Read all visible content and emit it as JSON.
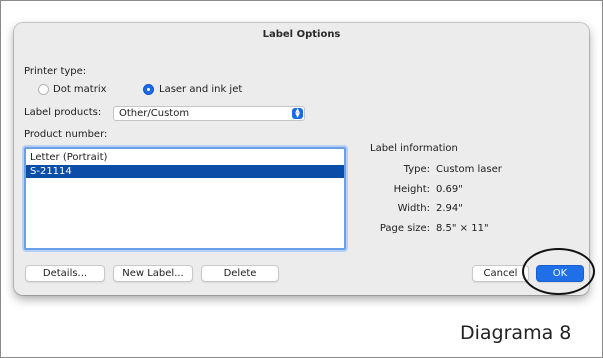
{
  "dialog": {
    "title": "Label Options"
  },
  "printer_type": {
    "label": "Printer type:",
    "options": [
      {
        "label": "Dot matrix",
        "selected": false
      },
      {
        "label": "Laser and ink jet",
        "selected": true
      }
    ]
  },
  "label_products": {
    "label": "Label products:",
    "value": "Other/Custom"
  },
  "product_number": {
    "label": "Product number:",
    "items": [
      {
        "label": "Letter (Portrait)",
        "selected": false
      },
      {
        "label": "S-21114",
        "selected": true
      }
    ]
  },
  "label_information": {
    "heading": "Label information",
    "rows": [
      {
        "key": "Type:",
        "value": "Custom laser"
      },
      {
        "key": "Height:",
        "value": "0.69\""
      },
      {
        "key": "Width:",
        "value": "2.94\""
      },
      {
        "key": "Page size:",
        "value": "8.5\" × 11\""
      }
    ]
  },
  "buttons": {
    "details": "Details...",
    "new_label": "New Label...",
    "delete": "Delete",
    "cancel": "Cancel",
    "ok": "OK"
  },
  "caption": "Diagrama 8",
  "colors": {
    "accent": "#1f6fe8",
    "selection": "#0a4ea8"
  }
}
